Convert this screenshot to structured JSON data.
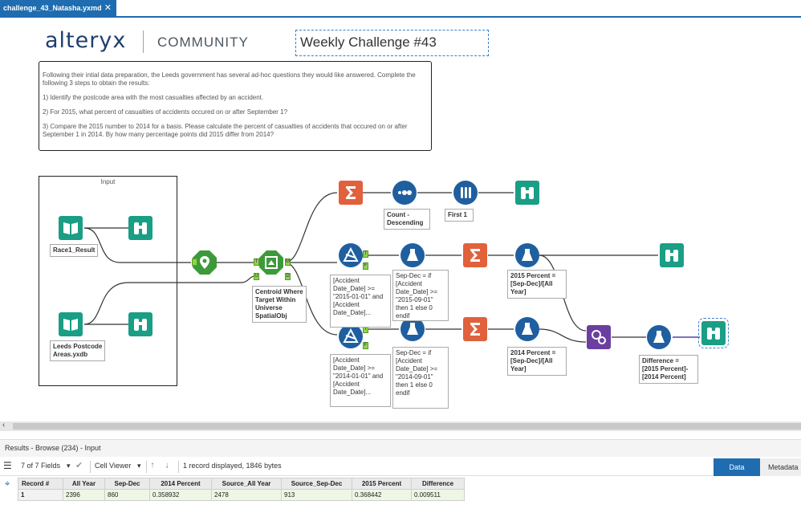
{
  "tab": {
    "title": "challenge_43_Natasha.yxmd",
    "close": "✕"
  },
  "header": {
    "logo": "alteryx",
    "community": "COMMUNITY",
    "challenge_title": "Weekly Challenge #43"
  },
  "description": [
    "Following their intial data preparation, the Leeds government has several ad-hoc questions they would like answered. Complete the following 3 steps to obtain the results:",
    "1)  Identify the postcode area with the most casualties affected by an accident.",
    "2) For 2015, what percent of casualties of accidents occured on or after September 1?",
    "3) Compare the 2015 number to 2014 for a basis. Please calculate the percent of casualties of accidents that occured on or after September 1 in 2014.  By how many percentage points did 2015 differ from 2014?"
  ],
  "container": {
    "label": "Input"
  },
  "annotations": {
    "race": "Race1_Result",
    "leeds": "Leeds Postcode\nAreas.yxdb",
    "spatial": "Centroid Where\nTarget Within\nUniverse\nSpatialObj",
    "count_desc": "Count -\nDescending",
    "first1": "First 1",
    "filter2015": "[Accident\nDate_Date] >=\n\"2015-01-01\" and\n[Accident\nDate_Date]...",
    "sepdec2015": "Sep-Dec = if\n[Accident\nDate_Date] >=\n\"2015-09-01\"\nthen 1 else 0\nendif",
    "pct2015": "2015 Percent =\n[Sep-Dec]/[All\nYear]",
    "filter2014": "[Accident\nDate_Date] >=\n\"2014-01-01\" and\n[Accident\nDate_Date]...",
    "sepdec2014": "Sep-Dec = if\n[Accident\nDate_Date] >=\n\"2014-09-01\"\nthen 1 else 0\nendif",
    "pct2014": "2014 Percent =\n[Sep-Dec]/[All\nYear]",
    "difference": "Difference =\n[2015 Percent]-\n[2014 Percent]"
  },
  "results": {
    "title": "Results - Browse (234) - Input",
    "fields": "7 of 7 Fields",
    "cell_viewer": "Cell Viewer",
    "record_info": "1 record displayed, 1846 bytes",
    "tab_data": "Data",
    "tab_metadata": "Metadata",
    "columns": [
      "Record #",
      "All Year",
      "Sep-Dec",
      "2014 Percent",
      "Source_All Year",
      "Source_Sep-Dec",
      "2015 Percent",
      "Difference"
    ],
    "rows": [
      [
        "1",
        "2396",
        "860",
        "0.358932",
        "2478",
        "913",
        "0.368442",
        "0.009511"
      ]
    ]
  },
  "anchors": {
    "true": "T",
    "false": "F",
    "match": "M",
    "universe": "U",
    "target": "T",
    "data": "D"
  },
  "colors": {
    "accent": "#1f6cb0",
    "input_tool": "#1a9e85",
    "browse_tool": "#1a9e85",
    "spatial_tool": "#3c9a3a",
    "summarize_tool": "#e0613c",
    "formula_tool": "#1f5fa0",
    "join_tool": "#6b3fa0"
  }
}
